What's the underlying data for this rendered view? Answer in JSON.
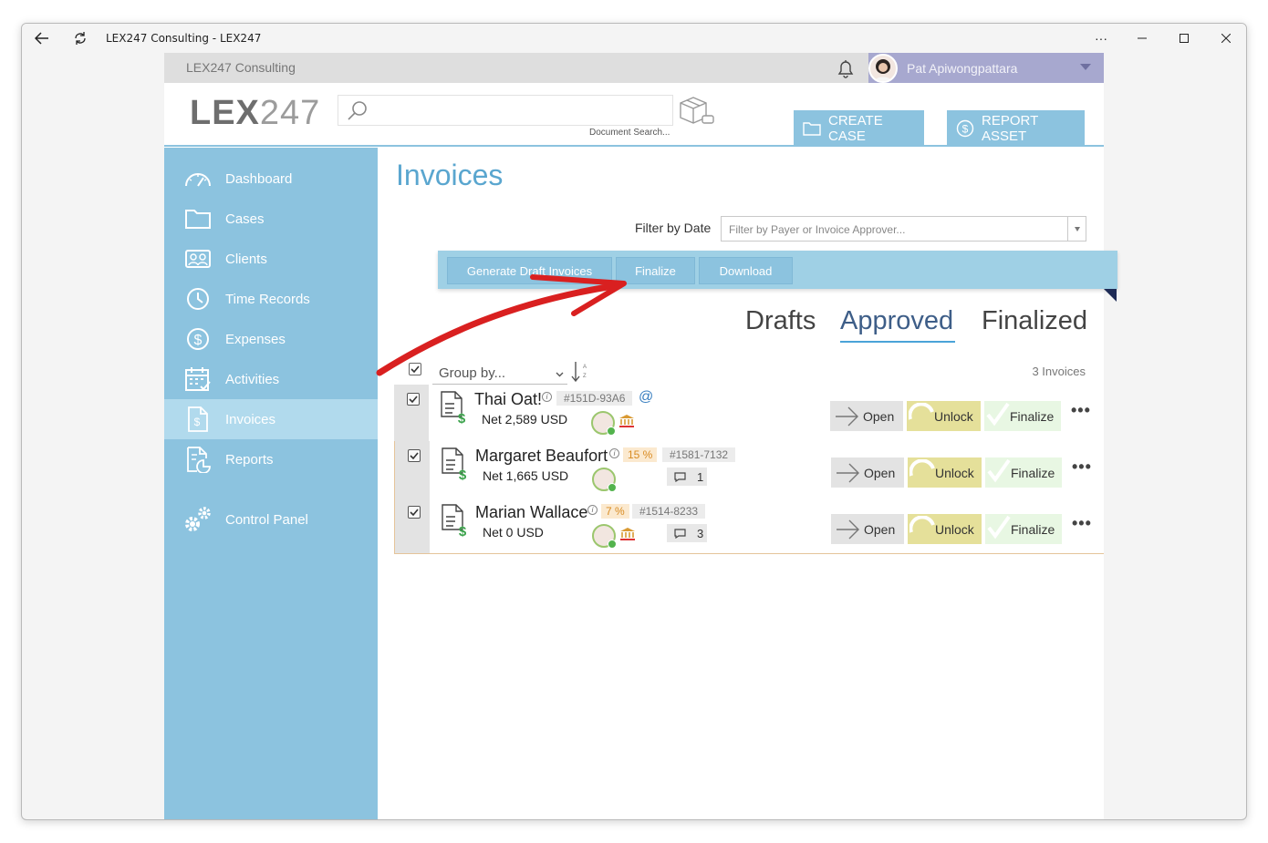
{
  "window": {
    "title": "LEX247 Consulting - LEX247"
  },
  "topbar": {
    "org": "LEX247 Consulting",
    "user": "Pat Apiwongpattara"
  },
  "header": {
    "logo_main": "LEX",
    "logo_num": "247",
    "search_placeholder": "",
    "search_caption": "Document Search...",
    "create_case": "CREATE CASE",
    "report_asset": "REPORT ASSET"
  },
  "sidebar": {
    "items": [
      {
        "label": "Dashboard",
        "icon": "dashboard-icon"
      },
      {
        "label": "Cases",
        "icon": "folder-icon"
      },
      {
        "label": "Clients",
        "icon": "clients-icon"
      },
      {
        "label": "Time Records",
        "icon": "clock-icon"
      },
      {
        "label": "Expenses",
        "icon": "dollar-icon"
      },
      {
        "label": "Activities",
        "icon": "calendar-icon"
      },
      {
        "label": "Invoices",
        "icon": "invoice-icon"
      },
      {
        "label": "Reports",
        "icon": "report-icon"
      },
      {
        "label": "Control Panel",
        "icon": "gears-icon"
      }
    ],
    "active": "Invoices"
  },
  "page": {
    "title": "Invoices",
    "filter_label": "Filter by Date",
    "filter_placeholder": "Filter by Payer or Invoice Approver..."
  },
  "actions": {
    "generate": "Generate Draft Invoices",
    "finalize": "Finalize",
    "download": "Download"
  },
  "tabs": {
    "drafts": "Drafts",
    "approved": "Approved",
    "finalized": "Finalized",
    "selected": "Approved"
  },
  "list": {
    "group_by": "Group by...",
    "count": "3 Invoices",
    "rows": [
      {
        "name": "Thai Oat!",
        "net": "Net 2,589 USD",
        "percent": "",
        "ref": "#151D-93A6",
        "at": "@",
        "comments": ""
      },
      {
        "name": "Margaret Beaufort",
        "net": "Net 1,665 USD",
        "percent": "15 %",
        "ref": "#1581-7132",
        "at": "",
        "comments": "1"
      },
      {
        "name": "Marian Wallace",
        "net": "Net 0 USD",
        "percent": "7 %",
        "ref": "#1514-8233",
        "at": "",
        "comments": "3"
      }
    ],
    "buttons": {
      "open": "Open",
      "unlock": "Unlock",
      "finalize": "Finalize",
      "more": "•••"
    }
  },
  "colors": {
    "sidebar": "#8cc3df",
    "active": "#b1daed",
    "title": "#5aa6cf",
    "annotation": "#d92020"
  }
}
